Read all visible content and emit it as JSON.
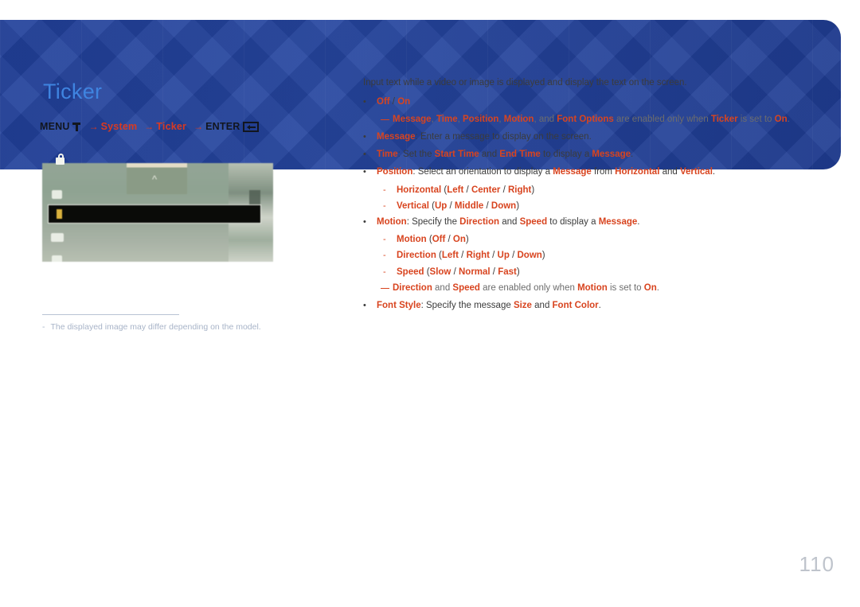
{
  "page": {
    "title": "Ticker",
    "number": "110"
  },
  "breadcrumb": {
    "menu_label": "MENU",
    "menu_icon": "menu-icon",
    "arrow": "→",
    "step1": "System",
    "step2": "Ticker",
    "enter_label": "ENTER",
    "enter_icon": "enter-key-icon"
  },
  "figure": {
    "caption_dash": "-",
    "caption": "The displayed image may differ depending on the model.",
    "lock_icon": "lock-icon",
    "chevron_icon": "chevron-up-icon"
  },
  "content": {
    "intro": "Input text while a video or image is displayed and display the text on the screen.",
    "bullet_marker": "•",
    "subbullet_marker": "-",
    "items": [
      {
        "marker": "•",
        "level": 1,
        "parts": [
          {
            "t": "Off",
            "s": "k"
          },
          {
            "t": " / ",
            "s": "dk"
          },
          {
            "t": "On",
            "s": "k"
          }
        ]
      },
      {
        "type": "note",
        "parts": [
          {
            "t": "Message",
            "s": "k"
          },
          {
            "t": ", ",
            "s": "gr"
          },
          {
            "t": "Time",
            "s": "k"
          },
          {
            "t": ", ",
            "s": "gr"
          },
          {
            "t": "Position",
            "s": "k"
          },
          {
            "t": ", ",
            "s": "gr"
          },
          {
            "t": "Motion",
            "s": "k"
          },
          {
            "t": ", and ",
            "s": "gr"
          },
          {
            "t": "Font Options",
            "s": "k"
          },
          {
            "t": " are enabled only when ",
            "s": "gr"
          },
          {
            "t": "Ticker",
            "s": "k"
          },
          {
            "t": " is set to ",
            "s": "gr"
          },
          {
            "t": "On",
            "s": "k"
          },
          {
            "t": ".",
            "s": "gr"
          }
        ]
      },
      {
        "marker": "•",
        "level": 1,
        "parts": [
          {
            "t": "Message",
            "s": "k"
          },
          {
            "t": ": Enter a message to display on the screen.",
            "s": "dk"
          }
        ]
      },
      {
        "marker": "•",
        "level": 1,
        "parts": [
          {
            "t": "Time",
            "s": "k"
          },
          {
            "t": ": Set the ",
            "s": "dk"
          },
          {
            "t": "Start Time",
            "s": "k"
          },
          {
            "t": " and ",
            "s": "dk"
          },
          {
            "t": "End Time",
            "s": "k"
          },
          {
            "t": " to display a ",
            "s": "dk"
          },
          {
            "t": "Message",
            "s": "k"
          },
          {
            "t": ".",
            "s": "dk"
          }
        ]
      },
      {
        "marker": "•",
        "level": 1,
        "parts": [
          {
            "t": "Position",
            "s": "k"
          },
          {
            "t": ": Select an orientation to display a ",
            "s": "dk"
          },
          {
            "t": "Message",
            "s": "k"
          },
          {
            "t": " from ",
            "s": "dk"
          },
          {
            "t": "Horizontal",
            "s": "k"
          },
          {
            "t": " and ",
            "s": "dk"
          },
          {
            "t": "Vertical",
            "s": "k"
          },
          {
            "t": ".",
            "s": "dk"
          }
        ]
      },
      {
        "marker": "-",
        "level": 2,
        "parts": [
          {
            "t": "Horizontal",
            "s": "k"
          },
          {
            "t": " (",
            "s": "dk"
          },
          {
            "t": "Left",
            "s": "k"
          },
          {
            "t": " / ",
            "s": "dk"
          },
          {
            "t": "Center",
            "s": "k"
          },
          {
            "t": " / ",
            "s": "dk"
          },
          {
            "t": "Right",
            "s": "k"
          },
          {
            "t": ")",
            "s": "dk"
          }
        ]
      },
      {
        "marker": "-",
        "level": 2,
        "parts": [
          {
            "t": "Vertical",
            "s": "k"
          },
          {
            "t": " (",
            "s": "dk"
          },
          {
            "t": "Up",
            "s": "k"
          },
          {
            "t": " / ",
            "s": "dk"
          },
          {
            "t": "Middle",
            "s": "k"
          },
          {
            "t": " / ",
            "s": "dk"
          },
          {
            "t": "Down",
            "s": "k"
          },
          {
            "t": ")",
            "s": "dk"
          }
        ]
      },
      {
        "marker": "•",
        "level": 1,
        "parts": [
          {
            "t": "Motion",
            "s": "k"
          },
          {
            "t": ": Specify the ",
            "s": "dk"
          },
          {
            "t": "Direction",
            "s": "k"
          },
          {
            "t": " and ",
            "s": "dk"
          },
          {
            "t": "Speed",
            "s": "k"
          },
          {
            "t": " to display a ",
            "s": "dk"
          },
          {
            "t": "Message",
            "s": "k"
          },
          {
            "t": ".",
            "s": "dk"
          }
        ]
      },
      {
        "marker": "-",
        "level": 2,
        "parts": [
          {
            "t": "Motion",
            "s": "k"
          },
          {
            "t": " (",
            "s": "dk"
          },
          {
            "t": "Off",
            "s": "k"
          },
          {
            "t": " / ",
            "s": "dk"
          },
          {
            "t": "On",
            "s": "k"
          },
          {
            "t": ")",
            "s": "dk"
          }
        ]
      },
      {
        "marker": "-",
        "level": 2,
        "parts": [
          {
            "t": "Direction",
            "s": "k"
          },
          {
            "t": " (",
            "s": "dk"
          },
          {
            "t": "Left",
            "s": "k"
          },
          {
            "t": " / ",
            "s": "dk"
          },
          {
            "t": "Right",
            "s": "k"
          },
          {
            "t": " / ",
            "s": "dk"
          },
          {
            "t": "Up",
            "s": "k"
          },
          {
            "t": " / ",
            "s": "dk"
          },
          {
            "t": "Down",
            "s": "k"
          },
          {
            "t": ")",
            "s": "dk"
          }
        ]
      },
      {
        "marker": "-",
        "level": 2,
        "parts": [
          {
            "t": "Speed",
            "s": "k"
          },
          {
            "t": " (",
            "s": "dk"
          },
          {
            "t": "Slow",
            "s": "k"
          },
          {
            "t": " / ",
            "s": "dk"
          },
          {
            "t": "Normal",
            "s": "k"
          },
          {
            "t": " / ",
            "s": "dk"
          },
          {
            "t": "Fast",
            "s": "k"
          },
          {
            "t": ")",
            "s": "dk"
          }
        ]
      },
      {
        "type": "note",
        "parts": [
          {
            "t": "Direction",
            "s": "k"
          },
          {
            "t": " and ",
            "s": "gr"
          },
          {
            "t": "Speed",
            "s": "k"
          },
          {
            "t": " are enabled only when ",
            "s": "gr"
          },
          {
            "t": "Motion",
            "s": "k"
          },
          {
            "t": " is set to ",
            "s": "gr"
          },
          {
            "t": "On",
            "s": "k"
          },
          {
            "t": ".",
            "s": "gr"
          }
        ]
      },
      {
        "marker": "•",
        "level": 1,
        "parts": [
          {
            "t": "Font Style",
            "s": "k"
          },
          {
            "t": ": Specify the message ",
            "s": "dk"
          },
          {
            "t": "Size",
            "s": "k"
          },
          {
            "t": " and ",
            "s": "dk"
          },
          {
            "t": "Font Color",
            "s": "k"
          },
          {
            "t": ".",
            "s": "dk"
          }
        ]
      }
    ]
  },
  "colors": {
    "banner": "#21409a",
    "title": "#3f84e0",
    "accent": "#d8441f",
    "breadcrumb_accent": "#d83a22",
    "body_text": "#3b3b3b",
    "note_text": "#6d6d6d",
    "footnote": "#a8b4c8",
    "page_number": "#bfc4cc"
  }
}
